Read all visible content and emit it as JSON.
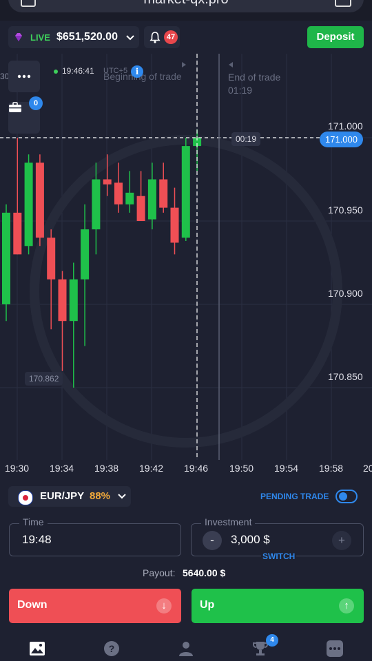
{
  "browser": {
    "url": "market-qx.pro"
  },
  "header": {
    "account_mode": "LIVE",
    "balance": "$651,520.00",
    "notifications_count": "47",
    "deposit_label": "Deposit"
  },
  "chart": {
    "clock": "19:46:41",
    "timezone": "UTC+5",
    "begin_label": "Beginning of trade",
    "end_label": "End of trade",
    "end_time": "01:19",
    "timer": "00:19",
    "current_price": "171.000",
    "low_price": "170.862",
    "trades_count": "0",
    "left_edge_label": "30"
  },
  "chart_data": {
    "type": "candlestick",
    "pair": "EUR/JPY",
    "ylim": [
      170.825,
      171.035
    ],
    "y_ticks": [
      "171.000",
      "170.950",
      "170.900",
      "170.850"
    ],
    "x_ticks": [
      "19:30",
      "19:34",
      "19:38",
      "19:42",
      "19:46",
      "19:50",
      "19:54",
      "19:58",
      "20"
    ],
    "candles": [
      {
        "o": 170.9,
        "h": 170.96,
        "l": 170.89,
        "c": 170.955
      },
      {
        "o": 170.955,
        "h": 171.0,
        "l": 170.93,
        "c": 170.93
      },
      {
        "o": 170.935,
        "h": 170.99,
        "l": 170.93,
        "c": 170.985
      },
      {
        "o": 170.985,
        "h": 170.99,
        "l": 170.935,
        "c": 170.94
      },
      {
        "o": 170.94,
        "h": 170.945,
        "l": 170.885,
        "c": 170.915
      },
      {
        "o": 170.915,
        "h": 170.92,
        "l": 170.86,
        "c": 170.89
      },
      {
        "o": 170.89,
        "h": 170.925,
        "l": 170.85,
        "c": 170.915
      },
      {
        "o": 170.915,
        "h": 170.96,
        "l": 170.875,
        "c": 170.945
      },
      {
        "o": 170.945,
        "h": 170.985,
        "l": 170.93,
        "c": 170.975
      },
      {
        "o": 170.975,
        "h": 170.99,
        "l": 170.965,
        "c": 170.972
      },
      {
        "o": 170.973,
        "h": 170.985,
        "l": 170.955,
        "c": 170.96
      },
      {
        "o": 170.96,
        "h": 170.98,
        "l": 170.955,
        "c": 170.967
      },
      {
        "o": 170.965,
        "h": 170.98,
        "l": 170.95,
        "c": 170.95
      },
      {
        "o": 170.951,
        "h": 170.985,
        "l": 170.945,
        "c": 170.975
      },
      {
        "o": 170.975,
        "h": 170.985,
        "l": 170.955,
        "c": 170.958
      },
      {
        "o": 170.958,
        "h": 170.97,
        "l": 170.93,
        "c": 170.937
      },
      {
        "o": 170.94,
        "h": 171.0,
        "l": 170.938,
        "c": 170.995
      },
      {
        "o": 170.995,
        "h": 171.005,
        "l": 170.98,
        "c": 171.0
      }
    ]
  },
  "trade_panel": {
    "pair": "EUR/JPY",
    "payout_pct": "88%",
    "pending_label": "PENDING TRADE",
    "time_label": "Time",
    "time_value": "19:48",
    "investment_label": "Investment",
    "investment_value": "3,000 $",
    "switch_label": "SWITCH",
    "payout_label": "Payout:",
    "payout_value": "5640.00 $",
    "down_label": "Down",
    "up_label": "Up"
  },
  "bottom_nav": {
    "tournaments_badge": "4"
  },
  "colors": {
    "up": "#1fc14a",
    "down": "#ef4f55",
    "accent": "#2f88ec",
    "bg": "#1e2131"
  }
}
